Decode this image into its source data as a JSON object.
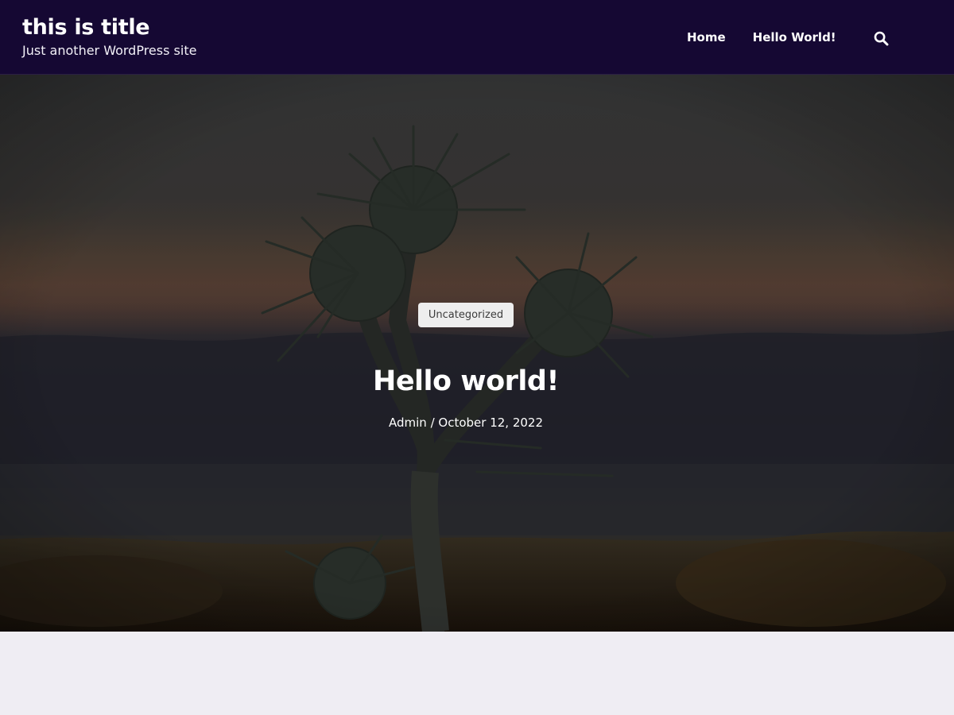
{
  "header": {
    "site_title": "this is title",
    "tagline": "Just another WordPress site",
    "background_color": "#150833",
    "nav": [
      {
        "label": "Home"
      },
      {
        "label": "Hello World!"
      }
    ],
    "search_icon": "search-icon"
  },
  "hero": {
    "background_image": "thistle plant silhouette at dusk",
    "category": "Uncategorized",
    "title": "Hello world!",
    "author": "Admin",
    "separator": "/",
    "date": "October 12, 2022"
  },
  "colors": {
    "page_background": "#efedf3",
    "badge_background": "#eeeeee"
  }
}
